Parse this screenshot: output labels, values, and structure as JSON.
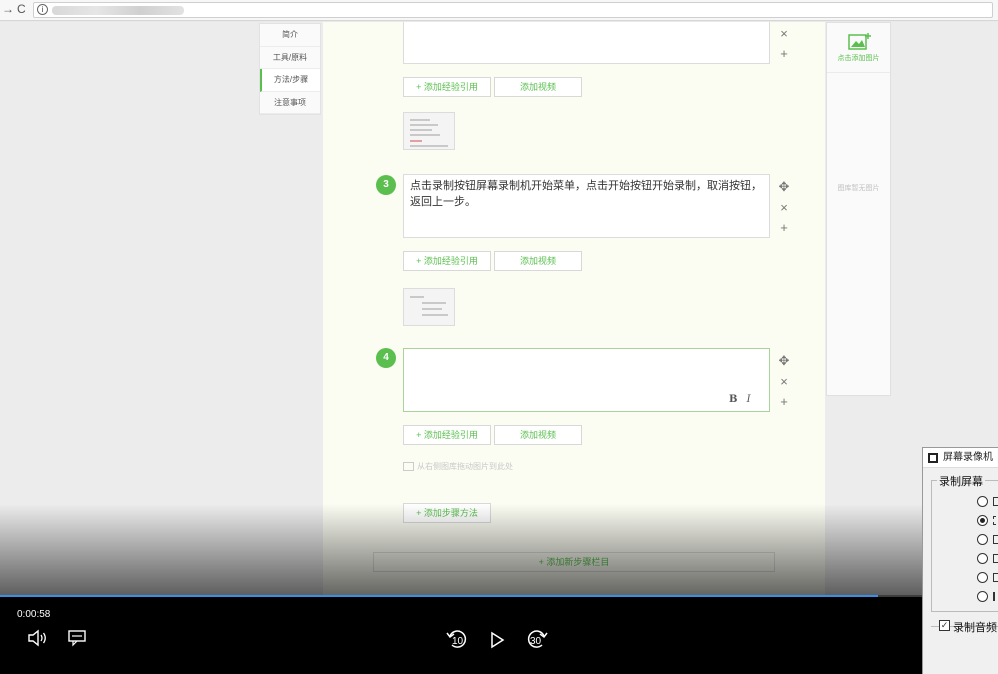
{
  "browser": {
    "back_glyph": "→",
    "reload_glyph": "C",
    "info_glyph": "i"
  },
  "side_nav": {
    "items": [
      {
        "label": "简介"
      },
      {
        "label": "工具/原料"
      },
      {
        "label": "方法/步骤"
      },
      {
        "label": "注意事项"
      }
    ]
  },
  "editor": {
    "add_reference_label": "+ 添加经验引用",
    "add_video_label": "添加视频",
    "steps": [
      {
        "number": "3",
        "text": "点击录制按钮屏幕录制机开始菜单，点击开始按钮开始录制，取消按钮，返回上一步。"
      },
      {
        "number": "4",
        "text": ""
      }
    ],
    "bold_label": "B",
    "italic_label": "I",
    "drag_hint": "从右侧图库拖动图片到此处",
    "add_step_method_label": "+ 添加步骤方法",
    "add_new_section_label": "+ 添加新步骤栏目"
  },
  "image_panel": {
    "add_image_label": "点击添加图片",
    "empty_label": "图库暂无图片"
  },
  "player": {
    "timecode": "0:00:58",
    "progress_fraction": 0.88,
    "skip_back_label": "10",
    "skip_forward_label": "30",
    "icons": [
      "volume-icon",
      "captions-icon",
      "skip-back-icon",
      "play-icon",
      "skip-forward-icon"
    ]
  },
  "recorder": {
    "title": "屏幕录像机",
    "group_label": "录制屏幕",
    "selected_mode_index": 1,
    "audio_label": "录制音频",
    "audio_checked": true
  },
  "colors": {
    "accent_green": "#5bbf4f",
    "progress_blue": "#3a8ee6"
  }
}
